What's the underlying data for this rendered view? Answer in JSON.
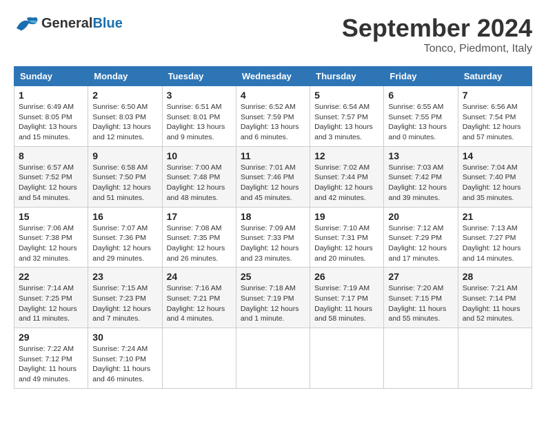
{
  "header": {
    "logo_general": "General",
    "logo_blue": "Blue",
    "month_title": "September 2024",
    "location": "Tonco, Piedmont, Italy"
  },
  "calendar": {
    "days_of_week": [
      "Sunday",
      "Monday",
      "Tuesday",
      "Wednesday",
      "Thursday",
      "Friday",
      "Saturday"
    ],
    "weeks": [
      [
        {
          "day": "1",
          "sunrise": "6:49 AM",
          "sunset": "8:05 PM",
          "daylight": "13 hours and 15 minutes."
        },
        {
          "day": "2",
          "sunrise": "6:50 AM",
          "sunset": "8:03 PM",
          "daylight": "13 hours and 12 minutes."
        },
        {
          "day": "3",
          "sunrise": "6:51 AM",
          "sunset": "8:01 PM",
          "daylight": "13 hours and 9 minutes."
        },
        {
          "day": "4",
          "sunrise": "6:52 AM",
          "sunset": "7:59 PM",
          "daylight": "13 hours and 6 minutes."
        },
        {
          "day": "5",
          "sunrise": "6:54 AM",
          "sunset": "7:57 PM",
          "daylight": "13 hours and 3 minutes."
        },
        {
          "day": "6",
          "sunrise": "6:55 AM",
          "sunset": "7:55 PM",
          "daylight": "13 hours and 0 minutes."
        },
        {
          "day": "7",
          "sunrise": "6:56 AM",
          "sunset": "7:54 PM",
          "daylight": "12 hours and 57 minutes."
        }
      ],
      [
        {
          "day": "8",
          "sunrise": "6:57 AM",
          "sunset": "7:52 PM",
          "daylight": "12 hours and 54 minutes."
        },
        {
          "day": "9",
          "sunrise": "6:58 AM",
          "sunset": "7:50 PM",
          "daylight": "12 hours and 51 minutes."
        },
        {
          "day": "10",
          "sunrise": "7:00 AM",
          "sunset": "7:48 PM",
          "daylight": "12 hours and 48 minutes."
        },
        {
          "day": "11",
          "sunrise": "7:01 AM",
          "sunset": "7:46 PM",
          "daylight": "12 hours and 45 minutes."
        },
        {
          "day": "12",
          "sunrise": "7:02 AM",
          "sunset": "7:44 PM",
          "daylight": "12 hours and 42 minutes."
        },
        {
          "day": "13",
          "sunrise": "7:03 AM",
          "sunset": "7:42 PM",
          "daylight": "12 hours and 39 minutes."
        },
        {
          "day": "14",
          "sunrise": "7:04 AM",
          "sunset": "7:40 PM",
          "daylight": "12 hours and 35 minutes."
        }
      ],
      [
        {
          "day": "15",
          "sunrise": "7:06 AM",
          "sunset": "7:38 PM",
          "daylight": "12 hours and 32 minutes."
        },
        {
          "day": "16",
          "sunrise": "7:07 AM",
          "sunset": "7:36 PM",
          "daylight": "12 hours and 29 minutes."
        },
        {
          "day": "17",
          "sunrise": "7:08 AM",
          "sunset": "7:35 PM",
          "daylight": "12 hours and 26 minutes."
        },
        {
          "day": "18",
          "sunrise": "7:09 AM",
          "sunset": "7:33 PM",
          "daylight": "12 hours and 23 minutes."
        },
        {
          "day": "19",
          "sunrise": "7:10 AM",
          "sunset": "7:31 PM",
          "daylight": "12 hours and 20 minutes."
        },
        {
          "day": "20",
          "sunrise": "7:12 AM",
          "sunset": "7:29 PM",
          "daylight": "12 hours and 17 minutes."
        },
        {
          "day": "21",
          "sunrise": "7:13 AM",
          "sunset": "7:27 PM",
          "daylight": "12 hours and 14 minutes."
        }
      ],
      [
        {
          "day": "22",
          "sunrise": "7:14 AM",
          "sunset": "7:25 PM",
          "daylight": "12 hours and 11 minutes."
        },
        {
          "day": "23",
          "sunrise": "7:15 AM",
          "sunset": "7:23 PM",
          "daylight": "12 hours and 7 minutes."
        },
        {
          "day": "24",
          "sunrise": "7:16 AM",
          "sunset": "7:21 PM",
          "daylight": "12 hours and 4 minutes."
        },
        {
          "day": "25",
          "sunrise": "7:18 AM",
          "sunset": "7:19 PM",
          "daylight": "12 hours and 1 minute."
        },
        {
          "day": "26",
          "sunrise": "7:19 AM",
          "sunset": "7:17 PM",
          "daylight": "11 hours and 58 minutes."
        },
        {
          "day": "27",
          "sunrise": "7:20 AM",
          "sunset": "7:15 PM",
          "daylight": "11 hours and 55 minutes."
        },
        {
          "day": "28",
          "sunrise": "7:21 AM",
          "sunset": "7:14 PM",
          "daylight": "11 hours and 52 minutes."
        }
      ],
      [
        {
          "day": "29",
          "sunrise": "7:22 AM",
          "sunset": "7:12 PM",
          "daylight": "11 hours and 49 minutes."
        },
        {
          "day": "30",
          "sunrise": "7:24 AM",
          "sunset": "7:10 PM",
          "daylight": "11 hours and 46 minutes."
        },
        null,
        null,
        null,
        null,
        null
      ]
    ],
    "labels": {
      "sunrise": "Sunrise:",
      "sunset": "Sunset:",
      "daylight": "Daylight:"
    }
  }
}
